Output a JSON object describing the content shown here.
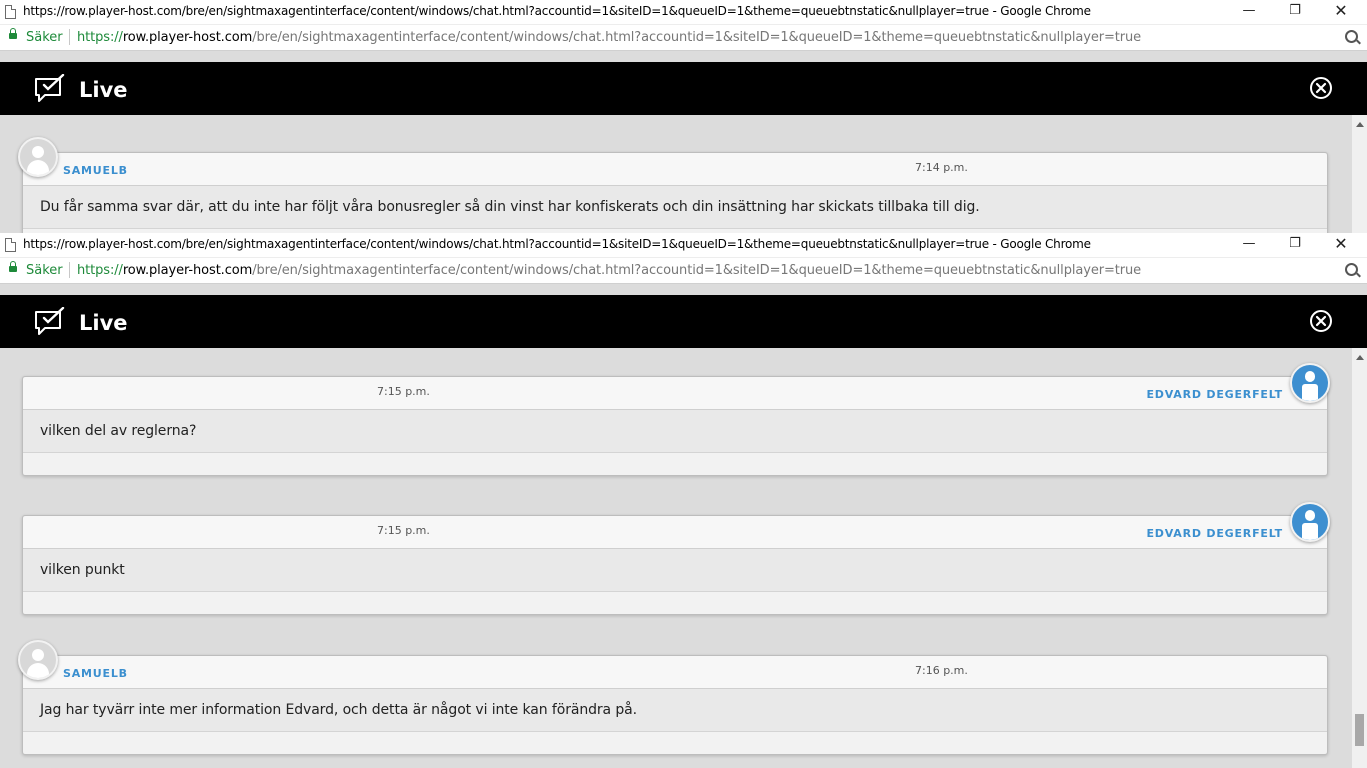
{
  "browser": {
    "window_title": "https://row.player-host.com/bre/en/sightmaxagentinterface/content/windows/chat.html?accountid=1&siteID=1&queueID=1&theme=queuebtnstatic&nullplayer=true - Google Chrome",
    "secure_label": "Säker",
    "url_scheme": "https://",
    "url_host": "row.player-host.com",
    "url_path": "/bre/en/sightmaxagentinterface/content/windows/chat.html?accountid=1&siteID=1&queueID=1&theme=queuebtnstatic&nullplayer=true",
    "minimize_glyph": "—",
    "maximize_glyph": "❐",
    "close_glyph": "✕"
  },
  "chat": {
    "header_title": "Live",
    "header_icon": "chat-check-icon",
    "close_icon": "close-circle-icon",
    "accent_color": "#3b8fcf",
    "header_color": "#000000"
  },
  "window1": {
    "scroll_thumb_fraction": 0.0,
    "messages": [
      {
        "sender": "SAMUELB",
        "side": "left",
        "time": "7:14 p.m.",
        "text": "Du får samma svar där, att du inte har följt våra bonusregler så din vinst har konfiskerats och din insättning har skickats tillbaka till dig."
      }
    ]
  },
  "window2": {
    "scroll_thumb_fraction": 1.0,
    "messages": [
      {
        "sender": "EDVARD DEGERFELT",
        "side": "right",
        "time": "7:15 p.m.",
        "text": "vilken del av reglerna?"
      },
      {
        "sender": "EDVARD DEGERFELT",
        "side": "right",
        "time": "7:15 p.m.",
        "text": "vilken punkt"
      },
      {
        "sender": "SAMUELB",
        "side": "left",
        "time": "7:16 p.m.",
        "text": "Jag har tyvärr inte mer information Edvard, och detta är något vi inte kan förändra på."
      }
    ]
  }
}
